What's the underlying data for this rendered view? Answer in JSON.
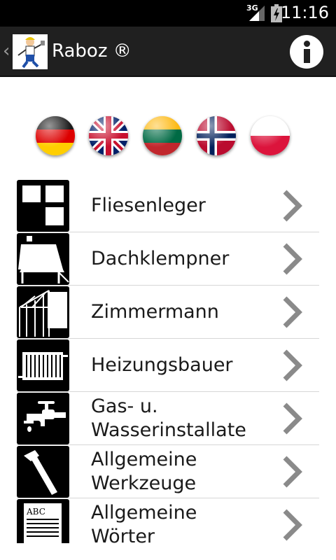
{
  "status_bar": {
    "time": "11:16",
    "network": "3G"
  },
  "action_bar": {
    "back_glyph": "‹",
    "title": "Raboz ®",
    "logo_icon": "worker-logo-icon",
    "info_icon": "info-icon"
  },
  "languages": [
    {
      "code": "de",
      "icon": "flag-germany-icon"
    },
    {
      "code": "en",
      "icon": "flag-uk-icon"
    },
    {
      "code": "lt",
      "icon": "flag-lithuania-icon"
    },
    {
      "code": "no",
      "icon": "flag-norway-icon"
    },
    {
      "code": "pl",
      "icon": "flag-poland-icon"
    }
  ],
  "categories": [
    {
      "label": "Fliesenleger",
      "icon": "tiles-icon"
    },
    {
      "label": "Dachklempner",
      "icon": "roof-icon"
    },
    {
      "label": "Zimmermann",
      "icon": "timber-frame-icon"
    },
    {
      "label": "Heizungsbauer",
      "icon": "radiator-icon"
    },
    {
      "label": "Gas- u.\nWasserinstallate",
      "icon": "faucet-icon"
    },
    {
      "label": "Allgemeine\nWerkzeuge",
      "icon": "hammer-icon"
    },
    {
      "label": "Allgemeine\nWörter",
      "icon": "document-abc-icon"
    }
  ],
  "icon_text": {
    "abc": "ABC"
  },
  "colors": {
    "actionbar": "#202020",
    "statusbar": "#000000",
    "divider": "#d6d6d6",
    "chevron": "#8a8a8a"
  }
}
